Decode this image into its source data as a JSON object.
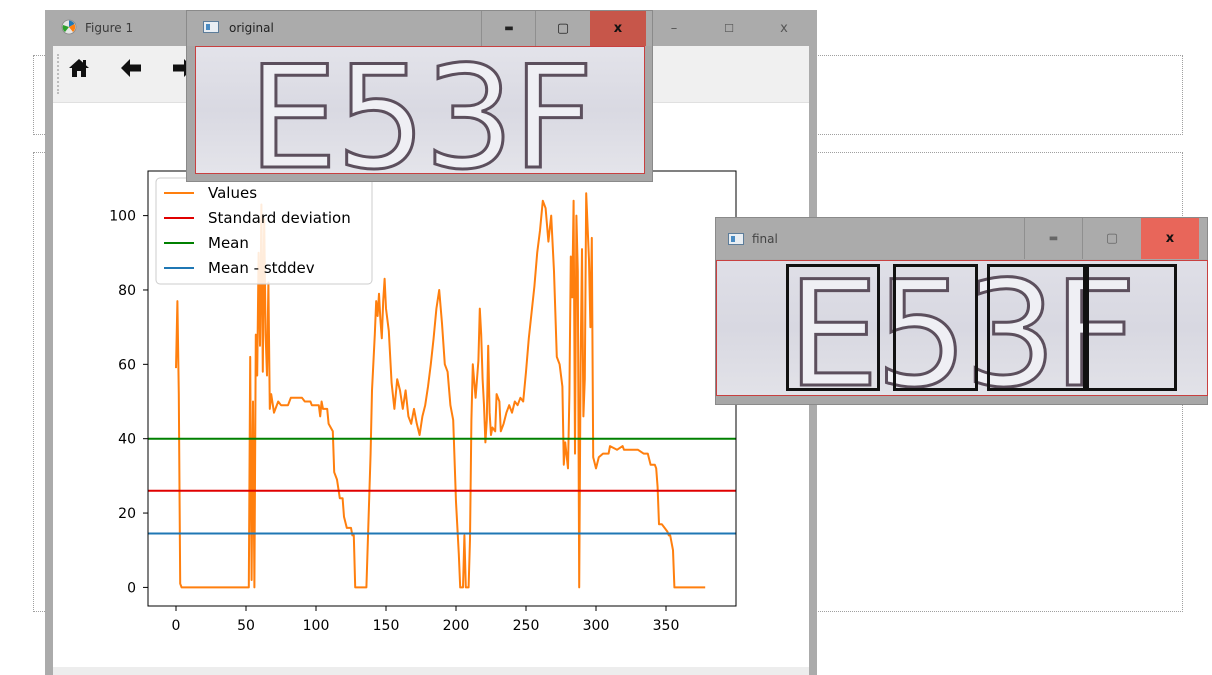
{
  "figure_window": {
    "title": "Figure 1",
    "controls": {
      "minimize": "–",
      "maximize": "☐",
      "close": "x"
    },
    "toolbar": [
      "home-icon",
      "back-arrow-icon",
      "forward-arrow-icon"
    ]
  },
  "original_window": {
    "title": "original",
    "image_text": "E53F",
    "controls": {
      "minimize": "▬",
      "maximize": "▢",
      "close": "x"
    },
    "close_color": "#c7564a"
  },
  "final_window": {
    "title": "final",
    "image_text": "E53F",
    "controls": {
      "minimize": "▬",
      "maximize": "▢",
      "close": "x"
    },
    "close_color": "#e8665a"
  },
  "chart_data": {
    "type": "line",
    "xlim": [
      -20,
      400
    ],
    "ylim": [
      -5,
      112
    ],
    "x_ticks": [
      0,
      50,
      100,
      150,
      200,
      250,
      300,
      350
    ],
    "y_ticks": [
      0,
      20,
      40,
      60,
      80,
      100
    ],
    "legend": {
      "position": "top-left",
      "entries": [
        "Values",
        "Standard deviation",
        "Mean",
        "Mean - stddev"
      ]
    },
    "series": [
      {
        "name": "Values",
        "color": "#ff7f0e",
        "points": [
          [
            0,
            59
          ],
          [
            1,
            77
          ],
          [
            2,
            52
          ],
          [
            3,
            1
          ],
          [
            4,
            0
          ],
          [
            20,
            0
          ],
          [
            40,
            0
          ],
          [
            52,
            0
          ],
          [
            53,
            62
          ],
          [
            54,
            2
          ],
          [
            55,
            50
          ],
          [
            56,
            0
          ],
          [
            57,
            68
          ],
          [
            58,
            57
          ],
          [
            59,
            90
          ],
          [
            60,
            65
          ],
          [
            61,
            103
          ],
          [
            62,
            58
          ],
          [
            63,
            99
          ],
          [
            64,
            68
          ],
          [
            65,
            57
          ],
          [
            66,
            82
          ],
          [
            67,
            48
          ],
          [
            68,
            52
          ],
          [
            70,
            47
          ],
          [
            73,
            50
          ],
          [
            75,
            49
          ],
          [
            80,
            49
          ],
          [
            82,
            51
          ],
          [
            90,
            51
          ],
          [
            92,
            50
          ],
          [
            96,
            50
          ],
          [
            97,
            49
          ],
          [
            102,
            49
          ],
          [
            103,
            46
          ],
          [
            104,
            50
          ],
          [
            105,
            48
          ],
          [
            108,
            48
          ],
          [
            109,
            44
          ],
          [
            112,
            42
          ],
          [
            113,
            31
          ],
          [
            115,
            29
          ],
          [
            117,
            24
          ],
          [
            119,
            24
          ],
          [
            120,
            19
          ],
          [
            122,
            16
          ],
          [
            125,
            16
          ],
          [
            126,
            14
          ],
          [
            127,
            14
          ],
          [
            128,
            0
          ],
          [
            136,
            0
          ],
          [
            137,
            12
          ],
          [
            139,
            36
          ],
          [
            140,
            53
          ],
          [
            142,
            68
          ],
          [
            143,
            77
          ],
          [
            144,
            73
          ],
          [
            145,
            79
          ],
          [
            146,
            72
          ],
          [
            147,
            67
          ],
          [
            148,
            77
          ],
          [
            149,
            83
          ],
          [
            150,
            75
          ],
          [
            152,
            69
          ],
          [
            154,
            55
          ],
          [
            156,
            48
          ],
          [
            158,
            56
          ],
          [
            160,
            53
          ],
          [
            162,
            48
          ],
          [
            164,
            53
          ],
          [
            166,
            46
          ],
          [
            168,
            44
          ],
          [
            170,
            48
          ],
          [
            172,
            44
          ],
          [
            174,
            41
          ],
          [
            176,
            46
          ],
          [
            178,
            49
          ],
          [
            180,
            54
          ],
          [
            182,
            60
          ],
          [
            184,
            67
          ],
          [
            186,
            75
          ],
          [
            188,
            80
          ],
          [
            190,
            71
          ],
          [
            192,
            60
          ],
          [
            194,
            58
          ],
          [
            196,
            49
          ],
          [
            198,
            45
          ],
          [
            200,
            23
          ],
          [
            202,
            9
          ],
          [
            203,
            0
          ],
          [
            205,
            0
          ],
          [
            206,
            14
          ],
          [
            207,
            0
          ],
          [
            209,
            0
          ],
          [
            210,
            13
          ],
          [
            211,
            45
          ],
          [
            212,
            60
          ],
          [
            214,
            51
          ],
          [
            216,
            61
          ],
          [
            217,
            75
          ],
          [
            218,
            68
          ],
          [
            219,
            56
          ],
          [
            220,
            49
          ],
          [
            221,
            39
          ],
          [
            222,
            45
          ],
          [
            223,
            65
          ],
          [
            224,
            47
          ],
          [
            225,
            41
          ],
          [
            226,
            43
          ],
          [
            228,
            42
          ],
          [
            229,
            52
          ],
          [
            231,
            50
          ],
          [
            232,
            42
          ],
          [
            234,
            44
          ],
          [
            236,
            47
          ],
          [
            238,
            49
          ],
          [
            240,
            47
          ],
          [
            242,
            50
          ],
          [
            244,
            49
          ],
          [
            246,
            51
          ],
          [
            248,
            50
          ],
          [
            250,
            58
          ],
          [
            252,
            67
          ],
          [
            254,
            74
          ],
          [
            256,
            81
          ],
          [
            258,
            90
          ],
          [
            260,
            96
          ],
          [
            262,
            104
          ],
          [
            264,
            102
          ],
          [
            266,
            93
          ],
          [
            268,
            100
          ],
          [
            270,
            85
          ],
          [
            272,
            62
          ],
          [
            274,
            60
          ],
          [
            276,
            54
          ],
          [
            277,
            33
          ],
          [
            278,
            39
          ],
          [
            280,
            32
          ],
          [
            281,
            52
          ],
          [
            282,
            89
          ],
          [
            283,
            78
          ],
          [
            284,
            104
          ],
          [
            285,
            36
          ],
          [
            286,
            100
          ],
          [
            287,
            85
          ],
          [
            288,
            0
          ],
          [
            289,
            60
          ],
          [
            290,
            91
          ],
          [
            291,
            46
          ],
          [
            292,
            56
          ],
          [
            293,
            106
          ],
          [
            295,
            88
          ],
          [
            296,
            70
          ],
          [
            297,
            94
          ],
          [
            298,
            35
          ],
          [
            300,
            32
          ],
          [
            302,
            35
          ],
          [
            305,
            36
          ],
          [
            309,
            36
          ],
          [
            310,
            38
          ],
          [
            315,
            37
          ],
          [
            319,
            38
          ],
          [
            320,
            37
          ],
          [
            325,
            37
          ],
          [
            330,
            37
          ],
          [
            334,
            36
          ],
          [
            337,
            36
          ],
          [
            339,
            33
          ],
          [
            342,
            33
          ],
          [
            343,
            32
          ],
          [
            344,
            27
          ],
          [
            345,
            17
          ],
          [
            347,
            17
          ],
          [
            349,
            16
          ],
          [
            351,
            15
          ],
          [
            352,
            14
          ],
          [
            353,
            14
          ],
          [
            355,
            10
          ],
          [
            356,
            0
          ],
          [
            360,
            0
          ],
          [
            378,
            0
          ]
        ]
      },
      {
        "name": "Standard deviation",
        "color": "#e00000",
        "hline": 26
      },
      {
        "name": "Mean",
        "color": "#008000",
        "hline": 40
      },
      {
        "name": "Mean - stddev",
        "color": "#1f77b4",
        "hline": 14.5
      }
    ]
  }
}
